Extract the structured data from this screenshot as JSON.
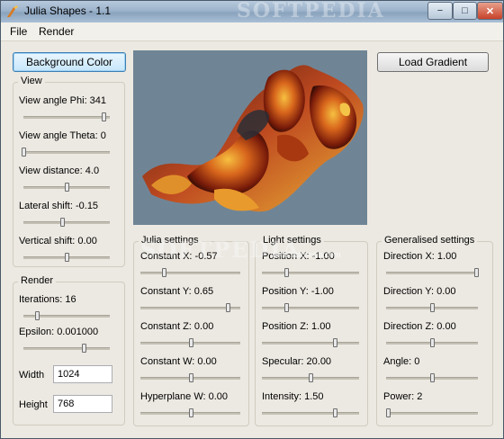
{
  "window": {
    "title": "Julia Shapes - 1.1",
    "watermark": "SOFTPEDIA",
    "controls": {
      "minimize": "−",
      "maximize": "□",
      "close": "✕"
    }
  },
  "menu": {
    "file": "File",
    "render": "Render"
  },
  "buttons": {
    "background_color": "Background Color",
    "load_gradient": "Load Gradient"
  },
  "view": {
    "title": "View",
    "phi": {
      "label": "View angle Phi: 341",
      "level": 0.93
    },
    "theta": {
      "label": "View angle Theta: 0",
      "level": 0.0
    },
    "distance": {
      "label": "View distance: 4.0",
      "level": 0.5
    },
    "lateral": {
      "label": "Lateral shift: -0.15",
      "level": 0.45
    },
    "vertical": {
      "label": "Vertical shift: 0.00",
      "level": 0.5
    }
  },
  "render": {
    "title": "Render",
    "iterations": {
      "label": "Iterations: 16",
      "level": 0.16
    },
    "epsilon": {
      "label": "Epsilon: 0.001000",
      "level": 0.7
    },
    "width": {
      "label": "Width",
      "value": "1024"
    },
    "height": {
      "label": "Height",
      "value": "768"
    }
  },
  "julia": {
    "title": "Julia settings",
    "cx": {
      "label": "Constant X: -0.57",
      "level": 0.23
    },
    "cy": {
      "label": "Constant Y: 0.65",
      "level": 0.87
    },
    "cz": {
      "label": "Constant Z: 0.00",
      "level": 0.5
    },
    "cw": {
      "label": "Constant W: 0.00",
      "level": 0.5
    },
    "hyper": {
      "label": "Hyperplane W: 0.00",
      "level": 0.5
    }
  },
  "light": {
    "title": "Light settings",
    "px": {
      "label": "Position X: -1.00",
      "level": 0.25
    },
    "py": {
      "label": "Position Y: -1.00",
      "level": 0.25
    },
    "pz": {
      "label": "Position Z: 1.00",
      "level": 0.75
    },
    "specular": {
      "label": "Specular: 20.00",
      "level": 0.5
    },
    "intensity": {
      "label": "Intensity: 1.50",
      "level": 0.75
    }
  },
  "generalised": {
    "title": "Generalised settings",
    "dx": {
      "label": "Direction X: 1.00",
      "level": 0.98
    },
    "dy": {
      "label": "Direction Y: 0.00",
      "level": 0.5
    },
    "dz": {
      "label": "Direction Z: 0.00",
      "level": 0.5
    },
    "angle": {
      "label": "Angle: 0",
      "level": 0.5
    },
    "power": {
      "label": "Power: 2",
      "level": 0.02
    }
  },
  "overlay_watermark": "SOFTPEDIA",
  "overlay_watermark_url": "www.softpedia.com",
  "colors": {
    "render_background": "#6f8596",
    "fractal_primary": "#c8511a",
    "fractal_highlight": "#f0b030"
  }
}
